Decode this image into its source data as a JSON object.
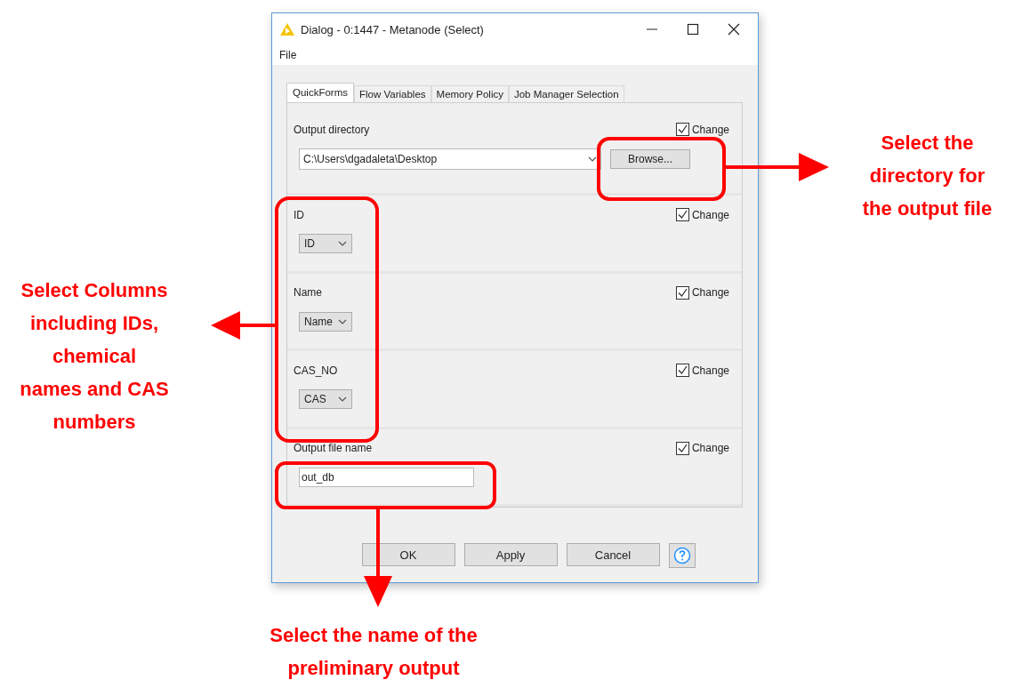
{
  "window": {
    "title": "Dialog - 0:1447 - Metanode (Select)"
  },
  "menu": [
    "File"
  ],
  "tabs": [
    {
      "label": "QuickForms",
      "selected": true
    },
    {
      "label": "Flow Variables",
      "selected": false
    },
    {
      "label": "Memory Policy",
      "selected": false
    },
    {
      "label": "Job Manager Selection",
      "selected": false
    }
  ],
  "sections": [
    {
      "kind": "folder",
      "label": "Output directory",
      "change": "Change",
      "checked": true,
      "value": "C:\\Users\\dgadaleta\\Desktop",
      "button": "Browse..."
    },
    {
      "kind": "select",
      "label": "ID",
      "change": "Change",
      "checked": true,
      "value": "ID"
    },
    {
      "kind": "select",
      "label": "Name",
      "change": "Change",
      "checked": true,
      "value": "Name"
    },
    {
      "kind": "select",
      "label": "CAS_NO",
      "change": "Change",
      "checked": true,
      "value": "CAS"
    },
    {
      "kind": "text",
      "label": "Output file name",
      "change": "Change",
      "checked": true,
      "value": "out_db"
    }
  ],
  "buttons": [
    "OK",
    "Apply",
    "Cancel"
  ],
  "annotations": [
    {
      "lines": [
        "Select the",
        "directory for",
        "the output file"
      ]
    },
    {
      "lines": [
        "Select Columns",
        "including IDs,",
        "chemical",
        "names and CAS",
        "numbers"
      ]
    },
    {
      "lines": [
        "Select the name of the",
        "preliminary output"
      ]
    }
  ]
}
